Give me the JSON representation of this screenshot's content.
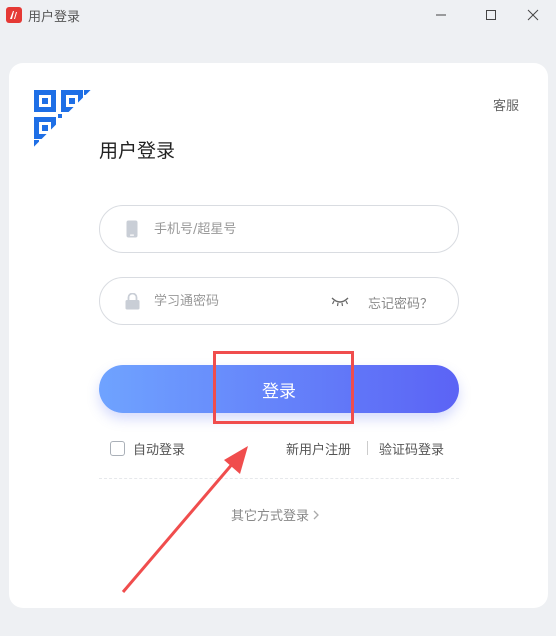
{
  "window": {
    "title": "用户登录",
    "controls": {
      "minimize_icon": "minimize-icon",
      "maximize_icon": "maximize-icon",
      "close_icon": "close-icon"
    }
  },
  "header": {
    "support_label": "客服",
    "login_title": "用户登录",
    "qr_icon": "qr-code-icon"
  },
  "form": {
    "phone": {
      "placeholder": "手机号/超星号",
      "value": "",
      "icon": "phone-icon"
    },
    "password": {
      "placeholder": "学习通密码",
      "value": "",
      "icon": "lock-icon",
      "toggle_icon": "eye-closed-icon"
    },
    "forgot_label": "忘记密码？",
    "login_button_label": "登录",
    "auto_login_label": "自动登录",
    "auto_login_checked": false,
    "register_label": "新用户注册",
    "code_login_label": "验证码登录",
    "other_login_label": "其它方式登录"
  },
  "colors": {
    "accent_start": "#6fa3ff",
    "accent_end": "#5b63f5",
    "qr_blue": "#1e6fe6",
    "annotation_red": "#f04d4d"
  }
}
